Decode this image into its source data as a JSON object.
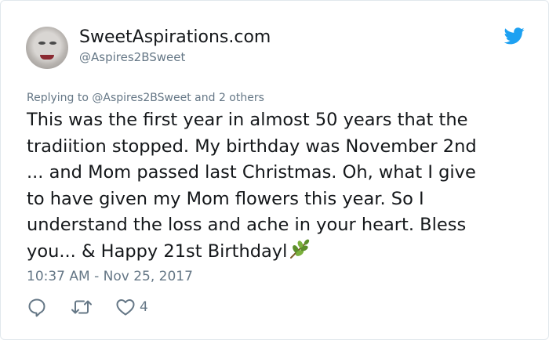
{
  "author": {
    "display_name": "SweetAspirations.com",
    "handle": "@Aspires2BSweet"
  },
  "tweet": {
    "replying_to": "Replying to @Aspires2BSweet and 2 others",
    "text": "This was the first year in almost 50 years that the\ntradiition stopped. My birthday was November 2nd\n... and Mom passed last Christmas. Oh, what I give\nto have given my Mom flowers this year. So I\nunderstand the loss and ache in your heart. Bless\nyou... & Happy 21st Birthdayl",
    "emoji_icon": "leaf-branch-icon",
    "timestamp": "10:37 AM - Nov 25, 2017"
  },
  "actions": {
    "like_count": "4",
    "icons": [
      "reply-icon",
      "retweet-icon",
      "like-icon"
    ]
  },
  "colors": {
    "text": "#14171a",
    "secondary": "#657786",
    "twitter_blue": "#1da1f2",
    "border": "#e1e8ed"
  }
}
